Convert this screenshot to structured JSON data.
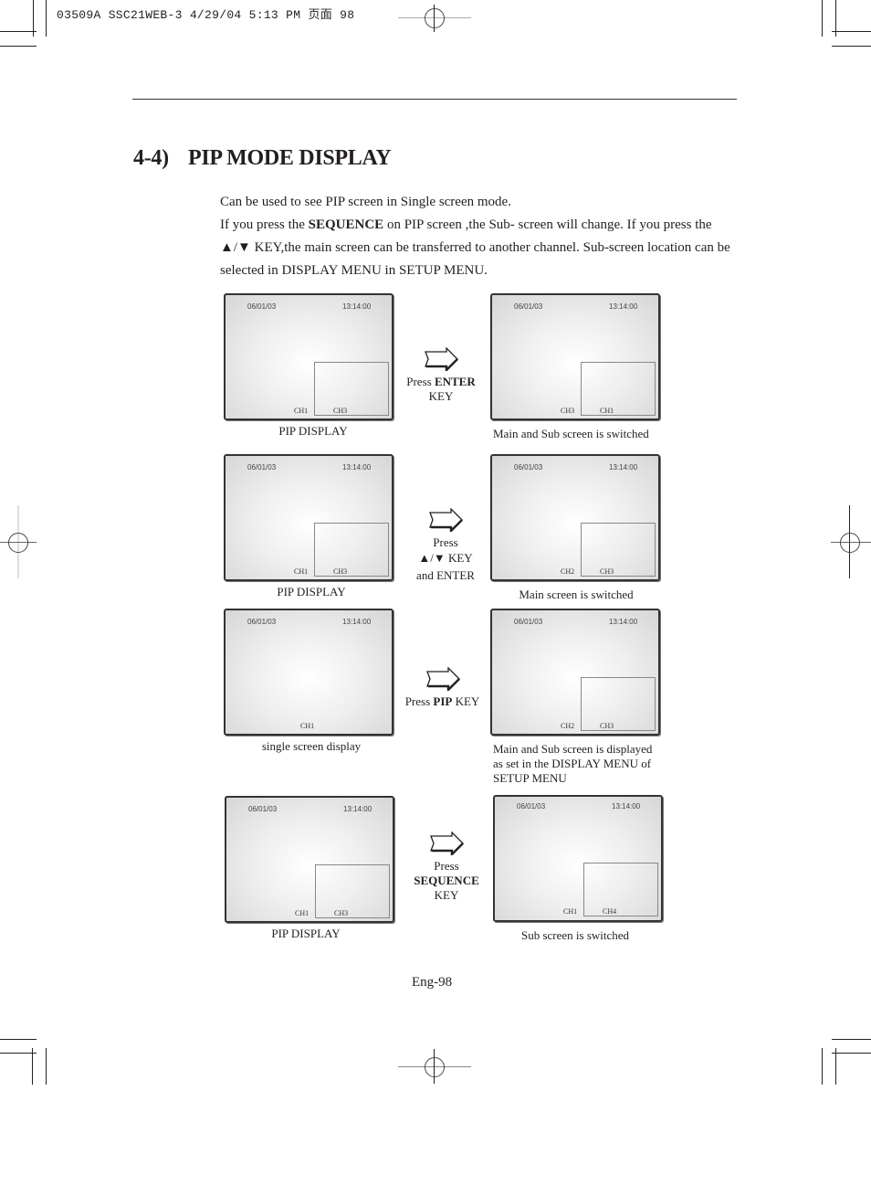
{
  "print_header": "03509A SSC21WEB-3  4/29/04  5:13 PM  页面 98",
  "section": {
    "number": "4-4)",
    "title": "PIP MODE DISPLAY"
  },
  "intro": {
    "line1": "Can be used to see PIP screen in Single screen mode.",
    "line2_pre": "If you press the ",
    "line2_bold": "SEQUENCE",
    "line2_post": " on PIP screen ,the Sub- screen will change. If you press the",
    "line3": "▲/▼ KEY,the main screen can be transferred to another channel. Sub-screen location can be",
    "line4": "selected in DISPLAY MENU in SETUP MENU."
  },
  "screen_overlay": {
    "date": "06/01/03",
    "time": "13:14:00"
  },
  "rows": [
    {
      "left": {
        "main": "CH1",
        "sub": "CH3",
        "caption": "PIP DISPLAY"
      },
      "action": {
        "line1_pre": "Press  ",
        "line1_bold": "ENTER",
        "line2": "KEY"
      },
      "right": {
        "main": "CH3",
        "sub": "CH1",
        "caption": "Main and Sub screen is switched"
      }
    },
    {
      "left": {
        "main": "CH1",
        "sub": "CH3",
        "caption": "PIP DISPLAY"
      },
      "action": {
        "line1": "Press",
        "line2": "▲/▼ KEY",
        "line3": "and ENTER"
      },
      "right": {
        "main": "CH2",
        "sub": "CH3",
        "caption": "Main screen is switched"
      }
    },
    {
      "left": {
        "main": "CH1",
        "caption": "single screen display"
      },
      "action": {
        "line1_pre": "Press ",
        "line1_bold": "PIP",
        "line1_post": " KEY"
      },
      "right": {
        "main": "CH2",
        "sub": "CH3",
        "caption_line1": "Main and Sub screen is displayed",
        "caption_line2": "as set in the DISPLAY MENU of",
        "caption_line3": "SETUP MENU"
      }
    },
    {
      "left": {
        "main": "CH1",
        "sub": "CH3",
        "caption": "PIP DISPLAY"
      },
      "action": {
        "line1": "Press",
        "line2_bold": "SEQUENCE",
        "line3": "KEY"
      },
      "right": {
        "main": "CH1",
        "sub": "CH4",
        "caption": "Sub screen is switched"
      }
    }
  ],
  "footer": {
    "page": "Eng-98"
  }
}
